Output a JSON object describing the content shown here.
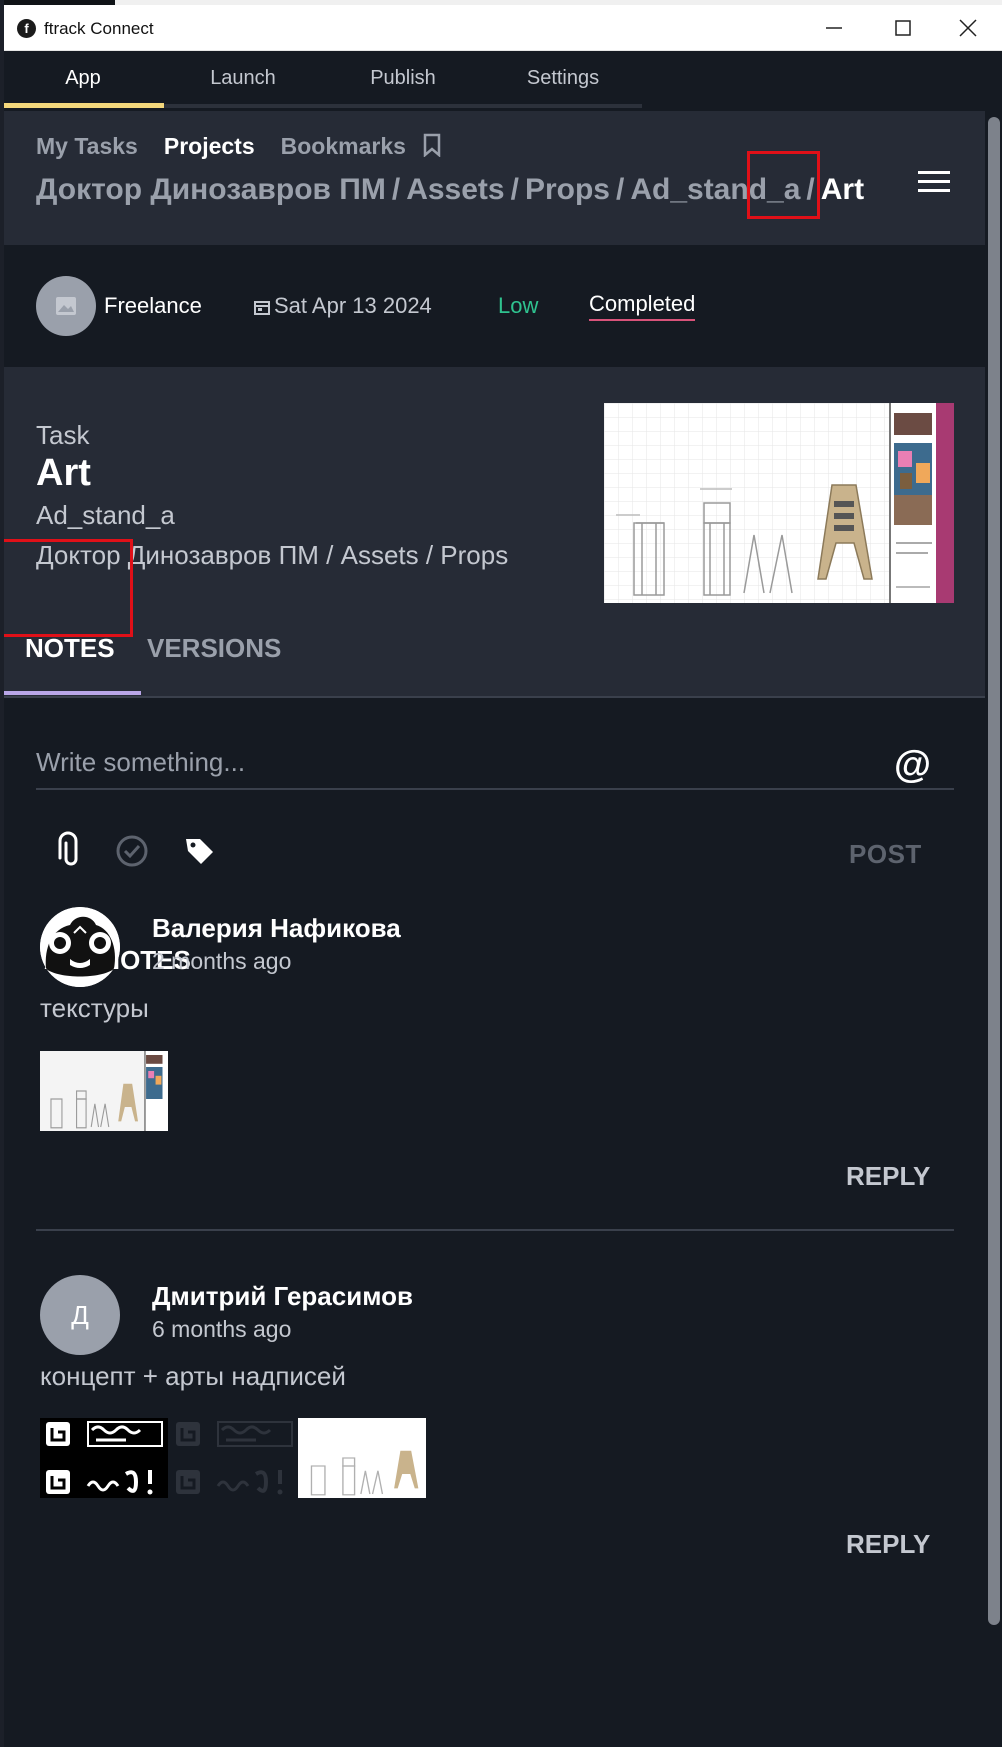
{
  "window": {
    "title": "ftrack Connect",
    "logo_letter": "f"
  },
  "topnav": {
    "tabs": [
      "App",
      "Launch",
      "Publish",
      "Settings"
    ],
    "active": "App"
  },
  "subtabs": {
    "items": [
      "My Tasks",
      "Projects",
      "Bookmarks"
    ],
    "active": "Projects"
  },
  "breadcrumb": {
    "items": [
      "Доктор Динозавров ПМ",
      "Assets",
      "Props",
      "Ad_stand_a"
    ],
    "current": "Art",
    "separator": "/"
  },
  "meta": {
    "assignee": "Freelance",
    "due_date": "Sat Apr 13 2024",
    "priority": "Low",
    "status": "Completed"
  },
  "task": {
    "type": "Task",
    "name": "Art",
    "parent": "Ad_stand_a",
    "path": "Доктор Динозавров ПМ / Assets / Props"
  },
  "content_tabs": {
    "items": [
      "NOTES",
      "VERSIONS"
    ],
    "active": "NOTES"
  },
  "composer": {
    "placeholder": "Write something...",
    "post_label": "POST"
  },
  "notes": {
    "header": "ALL NOTES",
    "items": [
      {
        "author": "Валерия Нафикова",
        "time": "2 months ago",
        "text": "текстуры",
        "reply": "REPLY"
      },
      {
        "author": "Дмитрий Герасимов",
        "initial": "Д",
        "time": "6 months ago",
        "text": "концепт + арты надписей",
        "reply": "REPLY"
      }
    ]
  },
  "colors": {
    "accent_underline": "#f3d77c",
    "priority_low": "#2fc28f",
    "status_underline": "#d8537a",
    "notes_tab_underline": "#b9a6e8",
    "highlight_box": "#e01018"
  }
}
